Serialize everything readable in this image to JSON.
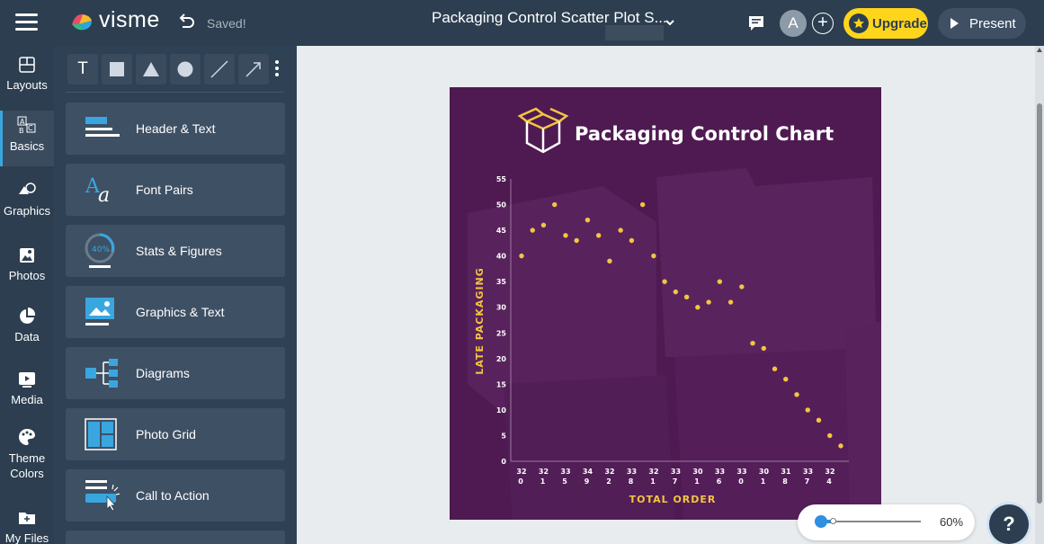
{
  "app": {
    "logo_text": "visme",
    "saved_status": "Saved!",
    "doc_title": "Packaging Control Scatter Plot S...",
    "avatar_initial": "A",
    "upgrade_label": "Upgrade",
    "present_label": "Present"
  },
  "rail": {
    "items": [
      {
        "label": "Layouts"
      },
      {
        "label": "Basics"
      },
      {
        "label": "Graphics"
      },
      {
        "label": "Photos"
      },
      {
        "label": "Data"
      },
      {
        "label": "Media"
      },
      {
        "label": "Theme",
        "label2": "Colors"
      },
      {
        "label": "My Files"
      }
    ]
  },
  "panel": {
    "shape_text_label": "T",
    "items": [
      {
        "label": "Header & Text"
      },
      {
        "label": "Font Pairs"
      },
      {
        "label": "Stats & Figures",
        "icon_text": "40%"
      },
      {
        "label": "Graphics & Text"
      },
      {
        "label": "Diagrams"
      },
      {
        "label": "Photo Grid"
      },
      {
        "label": "Call to Action"
      }
    ]
  },
  "zoom": {
    "value": 0.6,
    "label": "60%"
  },
  "help_label": "?",
  "colors": {
    "topbar": "#2c3e50",
    "panel": "#2f4154",
    "accent_blue": "#2f8fe0",
    "upgrade_yellow": "#ffd51c",
    "slide_bg": "#4f1a52",
    "chart_gold": "#f3c542"
  },
  "chart_data": {
    "type": "scatter",
    "title": "Packaging Control Chart",
    "xlabel": "TOTAL ORDER",
    "ylabel": "LATE PACKAGING",
    "ylim": [
      0,
      55
    ],
    "y_ticks": [
      "0",
      "5",
      "10",
      "15",
      "20",
      "25",
      "30",
      "35",
      "40",
      "45",
      "50",
      "55"
    ],
    "x_tick_labels": [
      {
        "top": "32",
        "bottom": "0"
      },
      {
        "top": "32",
        "bottom": "1"
      },
      {
        "top": "33",
        "bottom": "5"
      },
      {
        "top": "34",
        "bottom": "9"
      },
      {
        "top": "32",
        "bottom": "2"
      },
      {
        "top": "33",
        "bottom": "8"
      },
      {
        "top": "32",
        "bottom": "1"
      },
      {
        "top": "33",
        "bottom": "7"
      },
      {
        "top": "30",
        "bottom": "1"
      },
      {
        "top": "33",
        "bottom": "6"
      },
      {
        "top": "33",
        "bottom": "0"
      },
      {
        "top": "30",
        "bottom": "1"
      },
      {
        "top": "31",
        "bottom": "8"
      },
      {
        "top": "33",
        "bottom": "7"
      },
      {
        "top": "32",
        "bottom": "4"
      }
    ],
    "points": [
      40,
      45,
      46,
      50,
      44,
      43,
      47,
      44,
      39,
      45,
      43,
      50,
      40,
      35,
      33,
      32,
      30,
      31,
      35,
      31,
      34,
      23,
      22,
      18,
      16,
      13,
      10,
      8,
      5,
      3
    ],
    "grid": false
  }
}
